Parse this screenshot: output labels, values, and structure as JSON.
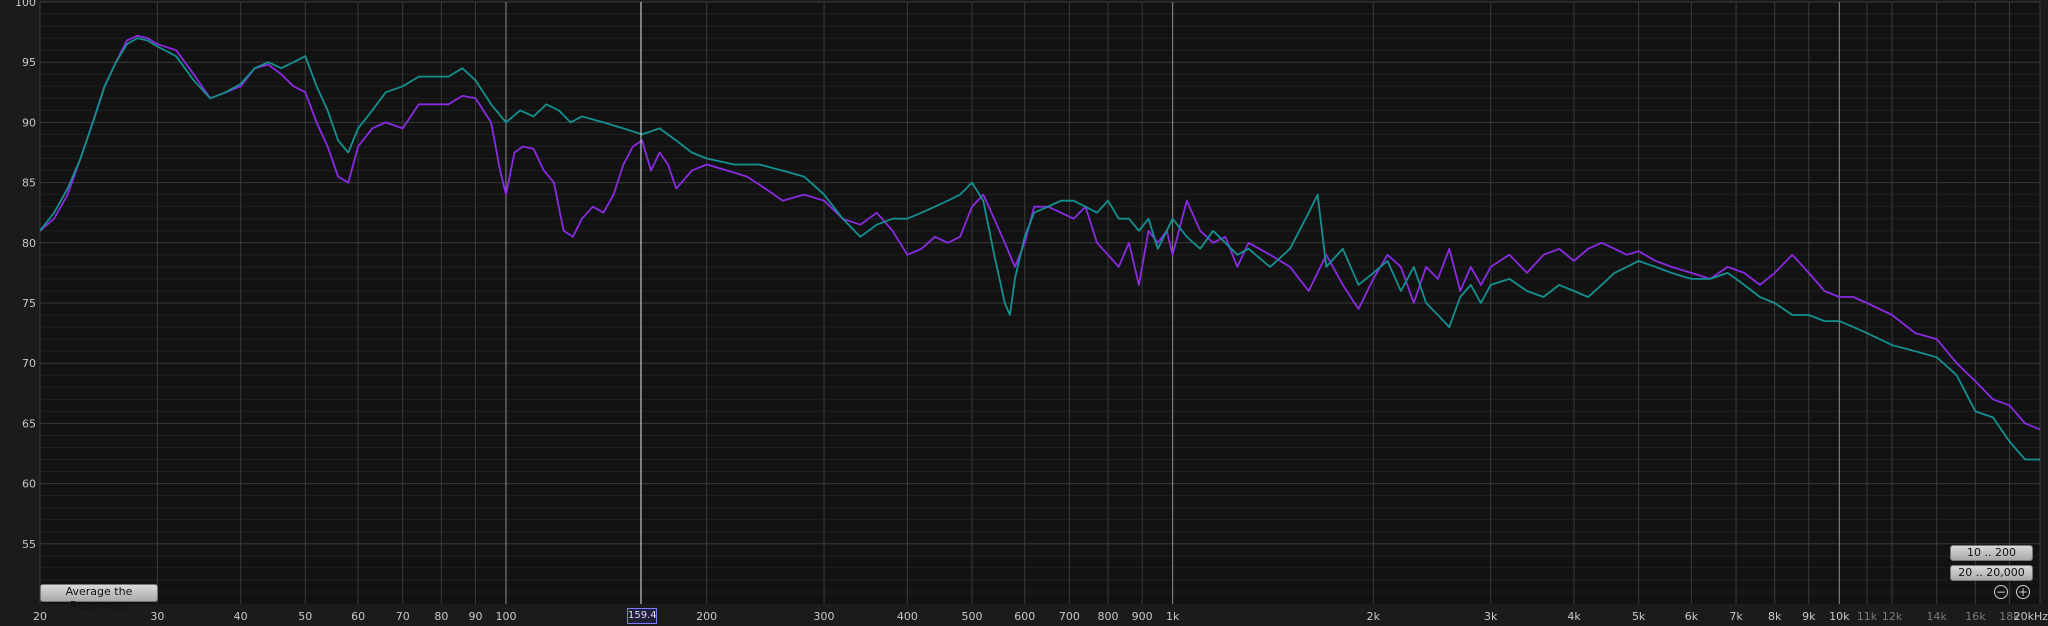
{
  "chart_data": {
    "type": "line",
    "x_scale": "log",
    "xlim": [
      20,
      20000
    ],
    "ylim": [
      50,
      100
    ],
    "grid": true,
    "y_ticks": [
      100,
      95,
      90,
      85,
      80,
      75,
      70,
      65,
      60,
      55
    ],
    "x_ticks": [
      {
        "value": 20,
        "label": "20"
      },
      {
        "value": 30,
        "label": "30"
      },
      {
        "value": 40,
        "label": "40"
      },
      {
        "value": 50,
        "label": "50"
      },
      {
        "value": 60,
        "label": "60"
      },
      {
        "value": 70,
        "label": "70"
      },
      {
        "value": 80,
        "label": "80"
      },
      {
        "value": 90,
        "label": "90"
      },
      {
        "value": 100,
        "label": "100"
      },
      {
        "value": 200,
        "label": "200"
      },
      {
        "value": 300,
        "label": "300"
      },
      {
        "value": 400,
        "label": "400"
      },
      {
        "value": 500,
        "label": "500"
      },
      {
        "value": 600,
        "label": "600"
      },
      {
        "value": 700,
        "label": "700"
      },
      {
        "value": 800,
        "label": "800"
      },
      {
        "value": 900,
        "label": "900"
      },
      {
        "value": 1000,
        "label": "1k"
      },
      {
        "value": 2000,
        "label": "2k"
      },
      {
        "value": 3000,
        "label": "3k"
      },
      {
        "value": 4000,
        "label": "4k"
      },
      {
        "value": 5000,
        "label": "5k"
      },
      {
        "value": 6000,
        "label": "6k"
      },
      {
        "value": 7000,
        "label": "7k"
      },
      {
        "value": 8000,
        "label": "8k"
      },
      {
        "value": 9000,
        "label": "9k"
      },
      {
        "value": 10000,
        "label": "10k"
      },
      {
        "value": 11000,
        "label": "11k"
      },
      {
        "value": 12000,
        "label": "12k"
      },
      {
        "value": 14000,
        "label": "14k"
      },
      {
        "value": 16000,
        "label": "16k"
      },
      {
        "value": 18000,
        "label": "18k"
      },
      {
        "value": 20000,
        "label": "20kHz"
      }
    ],
    "cursor": {
      "value": 159.4,
      "label": "159.4"
    },
    "series": [
      {
        "color": "#8a2be2",
        "points": [
          [
            20,
            81
          ],
          [
            21,
            82
          ],
          [
            22,
            84
          ],
          [
            23,
            87
          ],
          [
            24,
            90
          ],
          [
            25,
            93
          ],
          [
            26,
            95
          ],
          [
            27,
            96.8
          ],
          [
            28,
            97.2
          ],
          [
            29,
            97
          ],
          [
            30,
            96.5
          ],
          [
            32,
            96
          ],
          [
            34,
            94
          ],
          [
            36,
            92
          ],
          [
            38,
            92.5
          ],
          [
            40,
            93
          ],
          [
            42,
            94.5
          ],
          [
            44,
            94.8
          ],
          [
            46,
            94
          ],
          [
            48,
            93
          ],
          [
            50,
            92.5
          ],
          [
            52,
            90
          ],
          [
            54,
            88
          ],
          [
            56,
            85.5
          ],
          [
            58,
            85
          ],
          [
            60,
            88
          ],
          [
            63,
            89.5
          ],
          [
            66,
            90
          ],
          [
            70,
            89.5
          ],
          [
            74,
            91.5
          ],
          [
            78,
            91.5
          ],
          [
            82,
            91.5
          ],
          [
            86,
            92.2
          ],
          [
            90,
            92
          ],
          [
            95,
            90
          ],
          [
            98,
            86
          ],
          [
            100,
            84
          ],
          [
            103,
            87.5
          ],
          [
            106,
            88
          ],
          [
            110,
            87.8
          ],
          [
            114,
            86
          ],
          [
            118,
            85
          ],
          [
            122,
            81
          ],
          [
            126,
            80.5
          ],
          [
            130,
            82
          ],
          [
            135,
            83
          ],
          [
            140,
            82.5
          ],
          [
            145,
            84
          ],
          [
            150,
            86.5
          ],
          [
            155,
            88
          ],
          [
            160,
            88.5
          ],
          [
            165,
            86
          ],
          [
            170,
            87.5
          ],
          [
            175,
            86.5
          ],
          [
            180,
            84.5
          ],
          [
            190,
            86
          ],
          [
            200,
            86.5
          ],
          [
            215,
            86
          ],
          [
            230,
            85.5
          ],
          [
            245,
            84.5
          ],
          [
            260,
            83.5
          ],
          [
            280,
            84
          ],
          [
            300,
            83.5
          ],
          [
            320,
            82
          ],
          [
            340,
            81.5
          ],
          [
            360,
            82.5
          ],
          [
            380,
            81
          ],
          [
            400,
            79
          ],
          [
            420,
            79.5
          ],
          [
            440,
            80.5
          ],
          [
            460,
            80
          ],
          [
            480,
            80.5
          ],
          [
            500,
            83
          ],
          [
            520,
            84
          ],
          [
            540,
            82
          ],
          [
            560,
            80
          ],
          [
            580,
            78
          ],
          [
            600,
            80
          ],
          [
            620,
            83
          ],
          [
            650,
            83
          ],
          [
            680,
            82.5
          ],
          [
            710,
            82
          ],
          [
            740,
            83
          ],
          [
            770,
            80
          ],
          [
            800,
            79
          ],
          [
            830,
            78
          ],
          [
            860,
            80
          ],
          [
            890,
            76.5
          ],
          [
            920,
            81
          ],
          [
            950,
            80
          ],
          [
            980,
            81
          ],
          [
            1000,
            79
          ],
          [
            1050,
            83.5
          ],
          [
            1100,
            81
          ],
          [
            1150,
            80
          ],
          [
            1200,
            80.5
          ],
          [
            1250,
            78
          ],
          [
            1300,
            80
          ],
          [
            1400,
            79
          ],
          [
            1500,
            78
          ],
          [
            1600,
            76
          ],
          [
            1700,
            79
          ],
          [
            1800,
            76.5
          ],
          [
            1900,
            74.5
          ],
          [
            2000,
            77
          ],
          [
            2100,
            79
          ],
          [
            2200,
            78
          ],
          [
            2300,
            75
          ],
          [
            2400,
            78
          ],
          [
            2500,
            77
          ],
          [
            2600,
            79.5
          ],
          [
            2700,
            76
          ],
          [
            2800,
            78
          ],
          [
            2900,
            76.5
          ],
          [
            3000,
            78
          ],
          [
            3200,
            79
          ],
          [
            3400,
            77.5
          ],
          [
            3600,
            79
          ],
          [
            3800,
            79.5
          ],
          [
            4000,
            78.5
          ],
          [
            4200,
            79.5
          ],
          [
            4400,
            80
          ],
          [
            4600,
            79.5
          ],
          [
            4800,
            79
          ],
          [
            5000,
            79.3
          ],
          [
            5300,
            78.5
          ],
          [
            5600,
            78
          ],
          [
            6000,
            77.5
          ],
          [
            6400,
            77
          ],
          [
            6800,
            78
          ],
          [
            7200,
            77.5
          ],
          [
            7600,
            76.5
          ],
          [
            8000,
            77.5
          ],
          [
            8500,
            79
          ],
          [
            9000,
            77.5
          ],
          [
            9500,
            76
          ],
          [
            10000,
            75.5
          ],
          [
            10500,
            75.5
          ],
          [
            11000,
            75
          ],
          [
            12000,
            74
          ],
          [
            13000,
            72.5
          ],
          [
            14000,
            72
          ],
          [
            15000,
            70
          ],
          [
            16000,
            68.5
          ],
          [
            17000,
            67
          ],
          [
            18000,
            66.5
          ],
          [
            19000,
            65
          ],
          [
            20000,
            64.5
          ]
        ]
      },
      {
        "color": "#13908f",
        "points": [
          [
            20,
            81
          ],
          [
            21,
            82.5
          ],
          [
            22,
            84.5
          ],
          [
            23,
            87
          ],
          [
            24,
            90
          ],
          [
            25,
            93
          ],
          [
            26,
            95
          ],
          [
            27,
            96.5
          ],
          [
            28,
            97
          ],
          [
            29,
            96.8
          ],
          [
            30,
            96.3
          ],
          [
            32,
            95.5
          ],
          [
            34,
            93.5
          ],
          [
            36,
            92
          ],
          [
            38,
            92.5
          ],
          [
            40,
            93.2
          ],
          [
            42,
            94.5
          ],
          [
            44,
            95
          ],
          [
            46,
            94.5
          ],
          [
            48,
            95
          ],
          [
            50,
            95.5
          ],
          [
            52,
            93
          ],
          [
            54,
            91
          ],
          [
            56,
            88.5
          ],
          [
            58,
            87.5
          ],
          [
            60,
            89.5
          ],
          [
            63,
            91
          ],
          [
            66,
            92.5
          ],
          [
            70,
            93
          ],
          [
            74,
            93.8
          ],
          [
            78,
            93.8
          ],
          [
            82,
            93.8
          ],
          [
            86,
            94.5
          ],
          [
            90,
            93.5
          ],
          [
            95,
            91.5
          ],
          [
            100,
            90
          ],
          [
            105,
            91
          ],
          [
            110,
            90.5
          ],
          [
            115,
            91.5
          ],
          [
            120,
            91
          ],
          [
            125,
            90
          ],
          [
            130,
            90.5
          ],
          [
            140,
            90
          ],
          [
            150,
            89.5
          ],
          [
            160,
            89
          ],
          [
            170,
            89.5
          ],
          [
            180,
            88.5
          ],
          [
            190,
            87.5
          ],
          [
            200,
            87
          ],
          [
            220,
            86.5
          ],
          [
            240,
            86.5
          ],
          [
            260,
            86
          ],
          [
            280,
            85.5
          ],
          [
            300,
            84
          ],
          [
            320,
            82
          ],
          [
            340,
            80.5
          ],
          [
            360,
            81.5
          ],
          [
            380,
            82
          ],
          [
            400,
            82
          ],
          [
            420,
            82.5
          ],
          [
            440,
            83
          ],
          [
            460,
            83.5
          ],
          [
            480,
            84
          ],
          [
            500,
            85
          ],
          [
            520,
            83.5
          ],
          [
            540,
            79
          ],
          [
            560,
            75
          ],
          [
            570,
            74
          ],
          [
            580,
            77
          ],
          [
            600,
            80.5
          ],
          [
            620,
            82.5
          ],
          [
            650,
            83
          ],
          [
            680,
            83.5
          ],
          [
            710,
            83.5
          ],
          [
            740,
            83
          ],
          [
            770,
            82.5
          ],
          [
            800,
            83.5
          ],
          [
            830,
            82
          ],
          [
            860,
            82
          ],
          [
            890,
            81
          ],
          [
            920,
            82
          ],
          [
            950,
            79.5
          ],
          [
            980,
            81
          ],
          [
            1000,
            82
          ],
          [
            1050,
            80.5
          ],
          [
            1100,
            79.5
          ],
          [
            1150,
            81
          ],
          [
            1200,
            80
          ],
          [
            1250,
            79
          ],
          [
            1300,
            79.5
          ],
          [
            1400,
            78
          ],
          [
            1500,
            79.5
          ],
          [
            1600,
            82.5
          ],
          [
            1650,
            84
          ],
          [
            1700,
            78
          ],
          [
            1800,
            79.5
          ],
          [
            1900,
            76.5
          ],
          [
            2000,
            77.5
          ],
          [
            2100,
            78.5
          ],
          [
            2200,
            76
          ],
          [
            2300,
            78
          ],
          [
            2400,
            75
          ],
          [
            2500,
            74
          ],
          [
            2600,
            73
          ],
          [
            2700,
            75.5
          ],
          [
            2800,
            76.5
          ],
          [
            2900,
            75
          ],
          [
            3000,
            76.5
          ],
          [
            3200,
            77
          ],
          [
            3400,
            76
          ],
          [
            3600,
            75.5
          ],
          [
            3800,
            76.5
          ],
          [
            4000,
            76
          ],
          [
            4200,
            75.5
          ],
          [
            4400,
            76.5
          ],
          [
            4600,
            77.5
          ],
          [
            4800,
            78
          ],
          [
            5000,
            78.5
          ],
          [
            5300,
            78
          ],
          [
            5600,
            77.5
          ],
          [
            6000,
            77
          ],
          [
            6400,
            77
          ],
          [
            6800,
            77.5
          ],
          [
            7200,
            76.5
          ],
          [
            7600,
            75.5
          ],
          [
            8000,
            75
          ],
          [
            8500,
            74
          ],
          [
            9000,
            74
          ],
          [
            9500,
            73.5
          ],
          [
            10000,
            73.5
          ],
          [
            10500,
            73
          ],
          [
            11000,
            72.5
          ],
          [
            12000,
            71.5
          ],
          [
            13000,
            71
          ],
          [
            14000,
            70.5
          ],
          [
            15000,
            69
          ],
          [
            16000,
            66
          ],
          [
            17000,
            65.5
          ],
          [
            18000,
            63.5
          ],
          [
            19000,
            62
          ],
          [
            20000,
            62
          ]
        ]
      }
    ]
  },
  "buttons": {
    "average": "Average the Responses",
    "range_1": "10 .. 200",
    "range_2": "20 .. 20,000"
  },
  "zoom": {
    "out": "−",
    "in": "+"
  }
}
